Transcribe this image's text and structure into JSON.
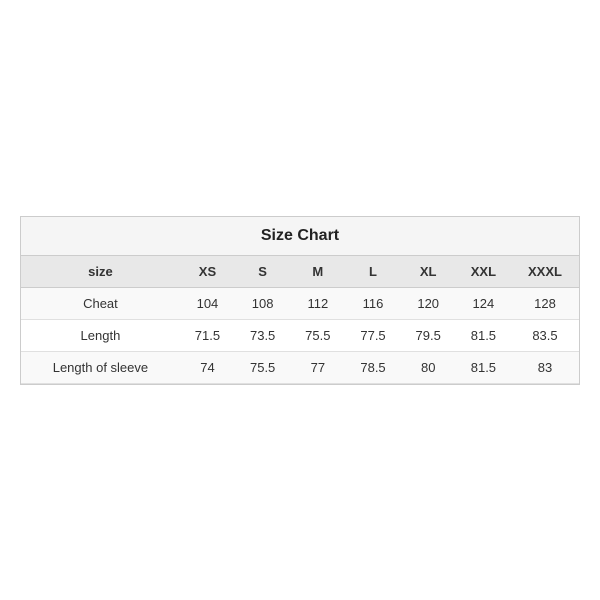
{
  "chart": {
    "title": "Size Chart",
    "headers": [
      "size",
      "XS",
      "S",
      "M",
      "L",
      "XL",
      "XXL",
      "XXXL"
    ],
    "rows": [
      {
        "label": "Cheat",
        "values": [
          "104",
          "108",
          "112",
          "116",
          "120",
          "124",
          "128"
        ]
      },
      {
        "label": "Length",
        "values": [
          "71.5",
          "73.5",
          "75.5",
          "77.5",
          "79.5",
          "81.5",
          "83.5"
        ]
      },
      {
        "label": "Length of sleeve",
        "values": [
          "74",
          "75.5",
          "77",
          "78.5",
          "80",
          "81.5",
          "83"
        ]
      }
    ]
  }
}
